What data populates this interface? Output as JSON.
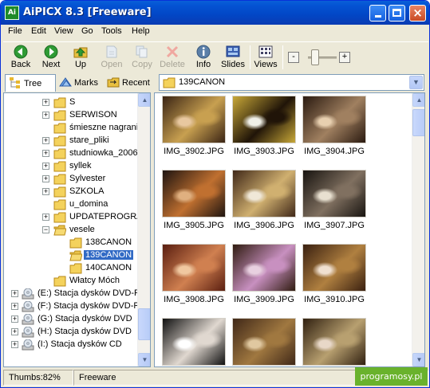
{
  "window": {
    "title": "AiPICX 8.3 [Freeware]",
    "app_icon_text": "Ai"
  },
  "menu": [
    "File",
    "Edit",
    "View",
    "Go",
    "Tools",
    "Help"
  ],
  "toolbar": {
    "buttons": [
      {
        "label": "Back",
        "icon": "back-arrow-icon",
        "enabled": true
      },
      {
        "label": "Next",
        "icon": "next-arrow-icon",
        "enabled": true
      },
      {
        "label": "Up",
        "icon": "up-arrow-icon",
        "enabled": true
      },
      {
        "label": "Open",
        "icon": "open-icon",
        "enabled": false
      },
      {
        "label": "Copy",
        "icon": "copy-icon",
        "enabled": false
      },
      {
        "label": "Delete",
        "icon": "delete-icon",
        "enabled": false
      },
      {
        "label": "Info",
        "icon": "info-icon",
        "enabled": true
      },
      {
        "label": "Slides",
        "icon": "slides-icon",
        "enabled": true
      },
      {
        "label": "Views",
        "icon": "views-icon",
        "enabled": true
      }
    ],
    "zoom_minus": "-",
    "zoom_plus": "+",
    "zoom_level": 0.25
  },
  "tabs": [
    {
      "label": "Tree",
      "icon": "tree-icon",
      "active": true
    },
    {
      "label": "Marks",
      "icon": "marks-icon",
      "active": false
    },
    {
      "label": "Recent",
      "icon": "recent-icon",
      "active": false
    }
  ],
  "path": {
    "value": "139CANON"
  },
  "tree": [
    {
      "label": "S",
      "level": 1,
      "expander": "+",
      "icon": "folder"
    },
    {
      "label": "SERWISON",
      "level": 1,
      "expander": "+",
      "icon": "folder"
    },
    {
      "label": "śmieszne nagrania",
      "level": 1,
      "expander": "",
      "icon": "folder"
    },
    {
      "label": "stare_pliki",
      "level": 1,
      "expander": "+",
      "icon": "folder"
    },
    {
      "label": "studniowka_2006",
      "level": 1,
      "expander": "+",
      "icon": "folder"
    },
    {
      "label": "syllek",
      "level": 1,
      "expander": "+",
      "icon": "folder"
    },
    {
      "label": "Sylvester",
      "level": 1,
      "expander": "+",
      "icon": "folder"
    },
    {
      "label": "SZKOLA",
      "level": 1,
      "expander": "+",
      "icon": "folder"
    },
    {
      "label": "u_domina",
      "level": 1,
      "expander": "",
      "icon": "folder"
    },
    {
      "label": "UPDATEPROGRAMC",
      "level": 1,
      "expander": "+",
      "icon": "folder"
    },
    {
      "label": "vesele",
      "level": 1,
      "expander": "−",
      "icon": "folder-open"
    },
    {
      "label": "138CANON",
      "level": 2,
      "expander": "",
      "icon": "folder"
    },
    {
      "label": "139CANON",
      "level": 2,
      "expander": "",
      "icon": "folder-open",
      "selected": true
    },
    {
      "label": "140CANON",
      "level": 2,
      "expander": "",
      "icon": "folder"
    },
    {
      "label": "Włatcy Móch",
      "level": 1,
      "expander": "",
      "icon": "folder"
    },
    {
      "label": "(E:) Stacja dysków DVD-F",
      "level": 0,
      "expander": "+",
      "icon": "drive"
    },
    {
      "label": "(F:) Stacja dysków DVD-F",
      "level": 0,
      "expander": "+",
      "icon": "drive"
    },
    {
      "label": "(G:) Stacja dysków DVD",
      "level": 0,
      "expander": "+",
      "icon": "drive"
    },
    {
      "label": "(H:) Stacja dysków DVD",
      "level": 0,
      "expander": "+",
      "icon": "drive"
    },
    {
      "label": "(I:) Stacja dysków CD",
      "level": 0,
      "expander": "+",
      "icon": "drive"
    }
  ],
  "thumbnails": [
    {
      "name": "IMG_3902.JPG",
      "palette": [
        "#3a2414",
        "#c8a050",
        "#e8c8a0"
      ]
    },
    {
      "name": "IMG_3903.JPG",
      "palette": [
        "#c8a838",
        "#201408",
        "#f0f0e8"
      ]
    },
    {
      "name": "IMG_3904.JPG",
      "palette": [
        "#2a1a10",
        "#a08060",
        "#e8d0b0"
      ]
    },
    {
      "name": "IMG_3905.JPG",
      "palette": [
        "#1e1410",
        "#c07030",
        "#e0b080"
      ]
    },
    {
      "name": "IMG_3906.JPG",
      "palette": [
        "#402818",
        "#d0b070",
        "#f0e8d8"
      ]
    },
    {
      "name": "IMG_3907.JPG",
      "palette": [
        "#181410",
        "#807060",
        "#e8e0d0"
      ]
    },
    {
      "name": "IMG_3908.JPG",
      "palette": [
        "#5a1e10",
        "#d08050",
        "#f0c8a0"
      ]
    },
    {
      "name": "IMG_3909.JPG",
      "palette": [
        "#301c10",
        "#c890c0",
        "#e8d0e0"
      ]
    },
    {
      "name": "IMG_3910.JPG",
      "palette": [
        "#3a2010",
        "#b08040",
        "#f0e0d0"
      ]
    },
    {
      "name": "",
      "palette": [
        "#101010",
        "#e0d8d0",
        "#ffffff"
      ]
    },
    {
      "name": "",
      "palette": [
        "#402818",
        "#a07840",
        "#e0c8a0"
      ]
    },
    {
      "name": "",
      "palette": [
        "#302010",
        "#b8a070",
        "#e8d8c8"
      ]
    }
  ],
  "status": {
    "thumbs": "Thumbs:82%",
    "license": "Freeware"
  },
  "watermark": "programosy.pl",
  "colors": {
    "title_blue": "#0453d3",
    "selection": "#316ac5",
    "watermark_green": "#69b22c"
  }
}
